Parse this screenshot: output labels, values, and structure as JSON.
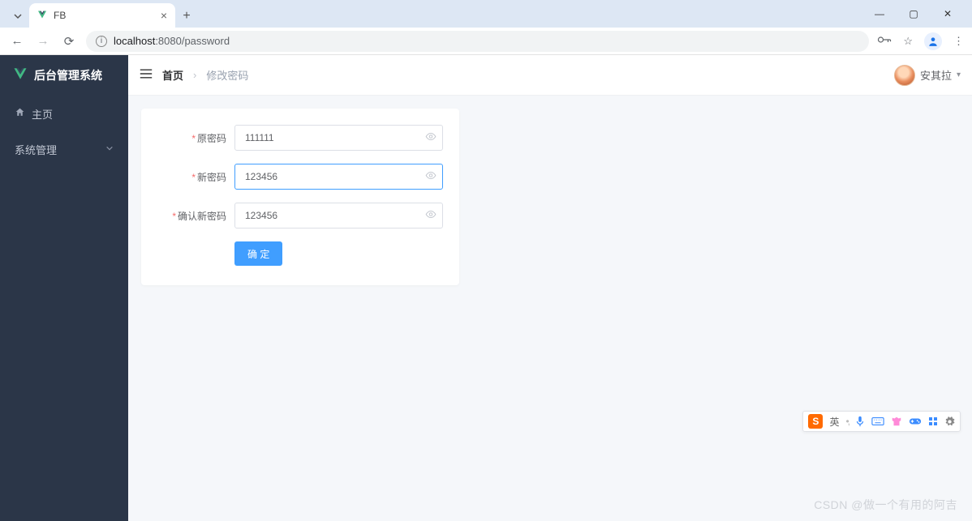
{
  "browser": {
    "tab_title": "FB",
    "url_host": "localhost",
    "url_port_path": ":8080/password"
  },
  "app": {
    "brand": "后台管理系统",
    "sidebar": {
      "home": "主页",
      "sys_mgmt": "系统管理"
    },
    "breadcrumb": {
      "home": "首页",
      "current": "修改密码"
    },
    "user": {
      "name": "安其拉"
    },
    "form": {
      "old_pwd_label": "原密码",
      "old_pwd_value": "111111",
      "new_pwd_label": "新密码",
      "new_pwd_value": "123456",
      "confirm_pwd_label": "确认新密码",
      "confirm_pwd_value": "123456",
      "submit_label": "确 定"
    }
  },
  "ime": {
    "logo": "S",
    "lang": "英"
  },
  "watermark": "CSDN @做一个有用的阿吉"
}
